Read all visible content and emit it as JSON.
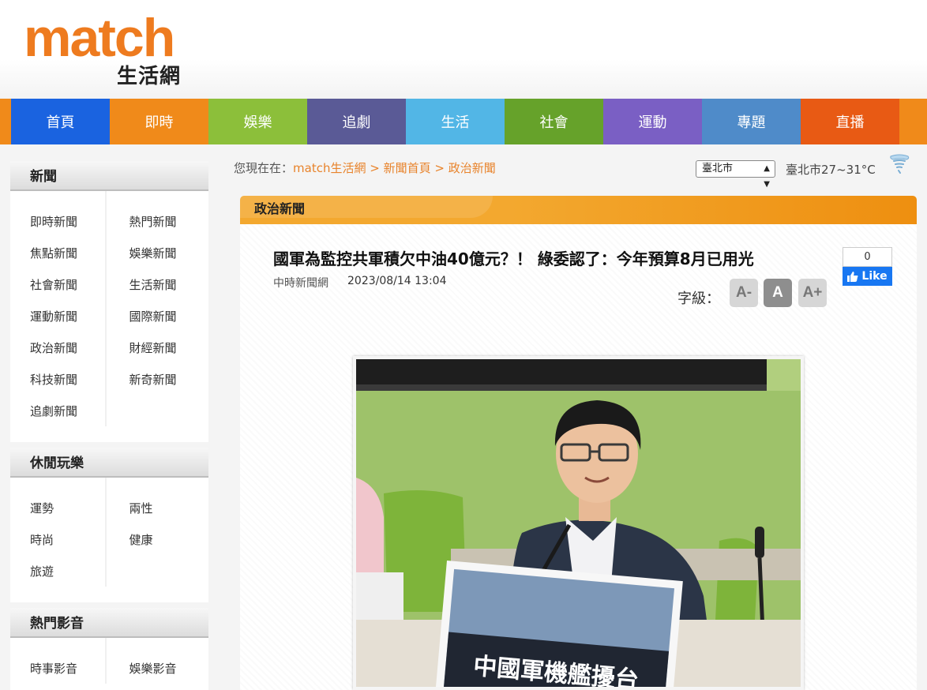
{
  "site": {
    "logo_main": "match",
    "logo_sub": "生活網"
  },
  "nav": {
    "items": [
      {
        "label": "首頁",
        "color": "#1a63e0"
      },
      {
        "label": "即時",
        "color": "#f08a1a"
      },
      {
        "label": "娛樂",
        "color": "#8cbf3a"
      },
      {
        "label": "追劇",
        "color": "#5a5a96"
      },
      {
        "label": "生活",
        "color": "#52b6e6"
      },
      {
        "label": "社會",
        "color": "#66a22a"
      },
      {
        "label": "運動",
        "color": "#7a5fc4"
      },
      {
        "label": "專題",
        "color": "#4f8bc9"
      },
      {
        "label": "直播",
        "color": "#e85a14"
      }
    ],
    "cap_color": "#f08a1a",
    "tail_color": "#f08a1a"
  },
  "sidebar": {
    "news": {
      "title": "新聞",
      "rows": [
        [
          "即時新聞",
          "熱門新聞"
        ],
        [
          "焦點新聞",
          "娛樂新聞"
        ],
        [
          "社會新聞",
          "生活新聞"
        ],
        [
          "運動新聞",
          "國際新聞"
        ],
        [
          "政治新聞",
          "財經新聞"
        ],
        [
          "科技新聞",
          "新奇新聞"
        ],
        [
          "追劇新聞",
          ""
        ]
      ]
    },
    "leisure": {
      "title": "休閒玩樂",
      "rows": [
        [
          "運勢",
          "兩性"
        ],
        [
          "時尚",
          "健康"
        ],
        [
          "旅遊",
          ""
        ]
      ]
    },
    "video": {
      "title": "熱門影音",
      "rows": [
        [
          "時事影音",
          "娛樂影音"
        ]
      ]
    }
  },
  "breadcrumb": {
    "prefix": "您現在在：",
    "items": [
      "match生活網",
      "新聞首頁",
      "政治新聞"
    ],
    "separator": " > "
  },
  "weather": {
    "city": "臺北市",
    "text": "臺北市27~31°C"
  },
  "article": {
    "category": "政治新聞",
    "title": "國軍為監控共軍積欠中油40億元？！ 綠委認了：今年預算8月已用光",
    "source": "中時新聞網",
    "date": "2023/08/14 13:04",
    "fb_count": "0",
    "fb_like": "Like",
    "font_label": "字級：",
    "font_buttons": [
      "A-",
      "A",
      "A+"
    ],
    "photo_sign": "中國軍機艦擾台"
  }
}
